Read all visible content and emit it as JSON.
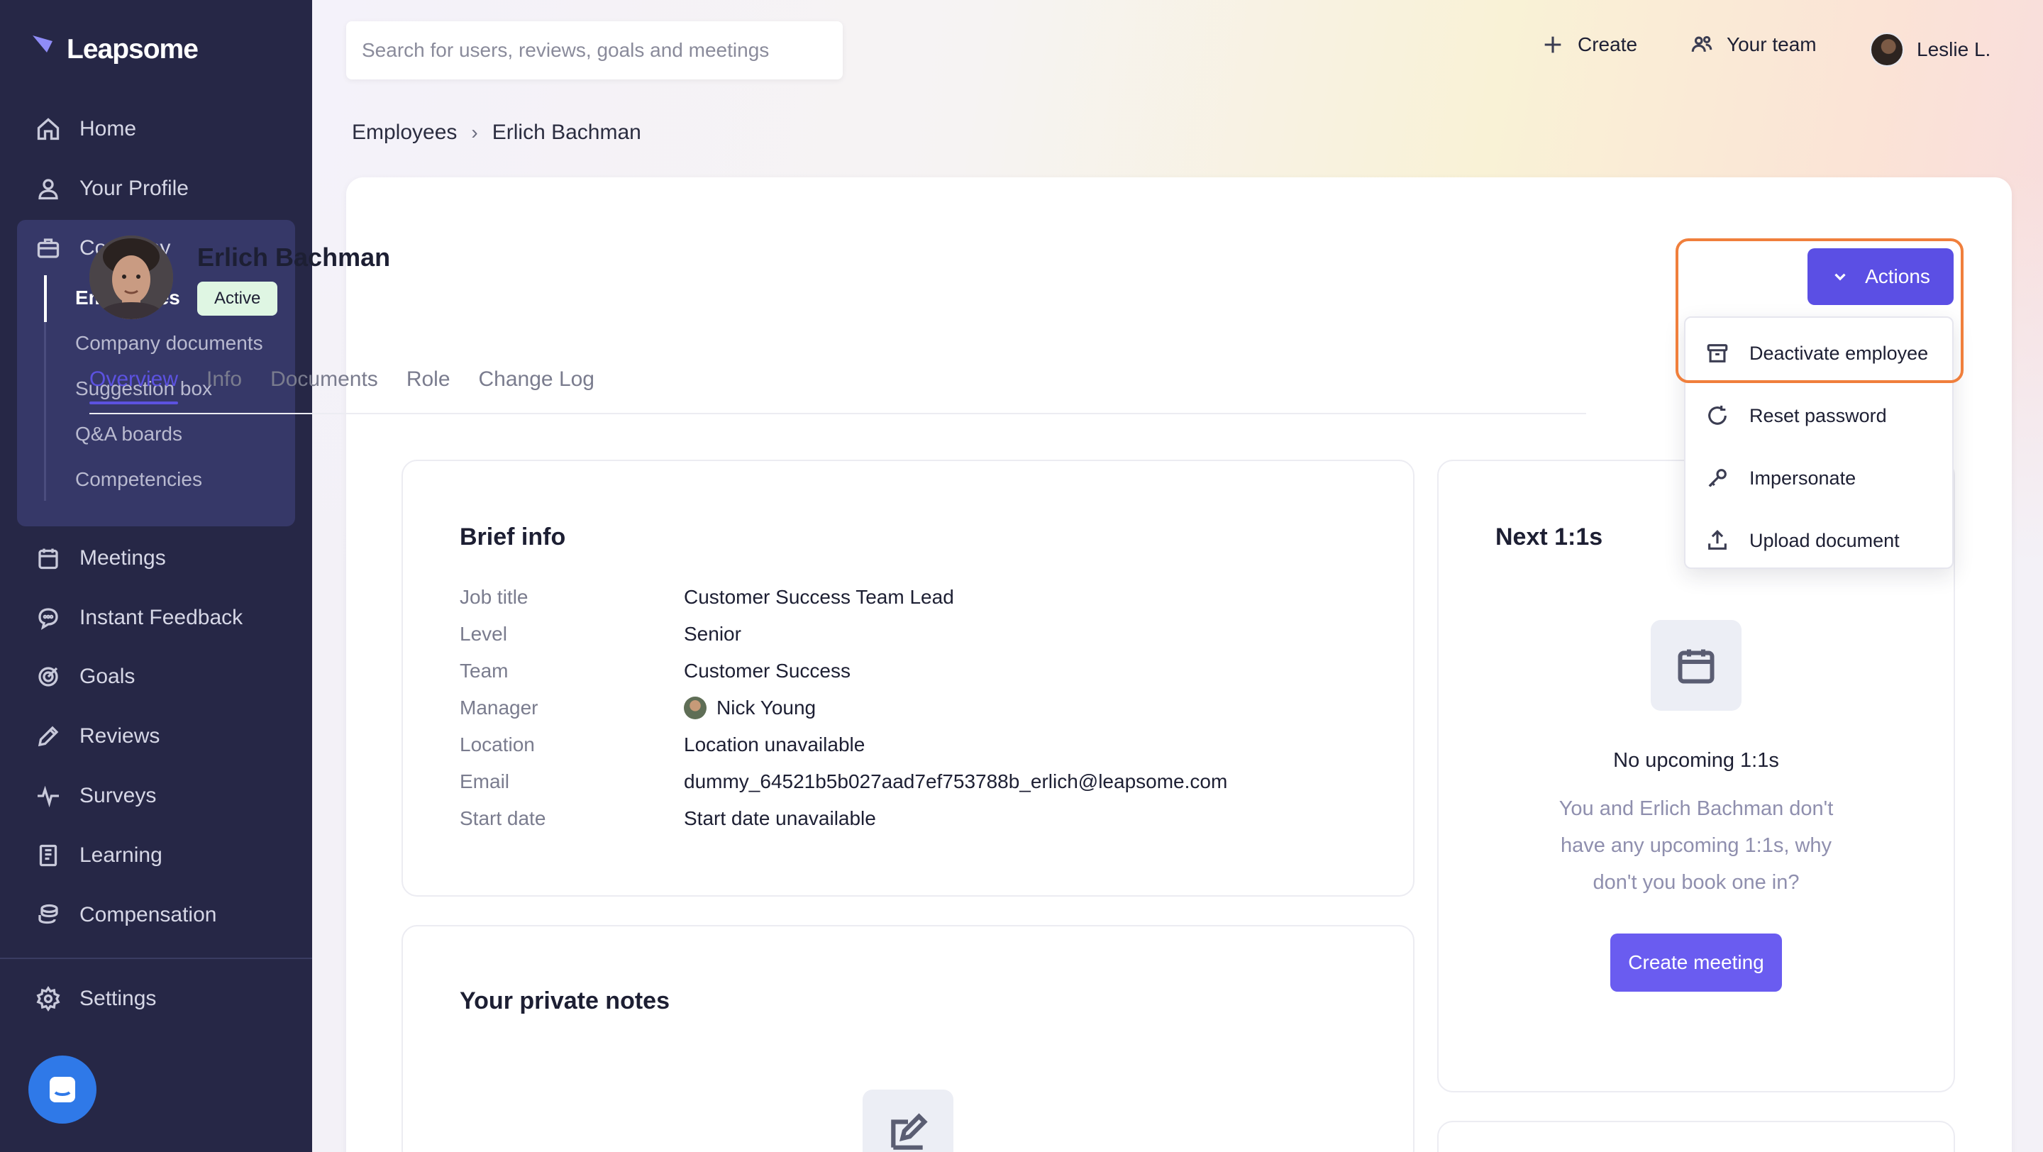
{
  "app": {
    "name": "Leapsome"
  },
  "sidebar": {
    "items": [
      {
        "label": "Home",
        "icon": "home-icon"
      },
      {
        "label": "Your Profile",
        "icon": "user-icon"
      },
      {
        "label": "Company",
        "icon": "briefcase-icon"
      },
      {
        "label": "Meetings",
        "icon": "calendar-icon"
      },
      {
        "label": "Instant Feedback",
        "icon": "chat-bubble-icon"
      },
      {
        "label": "Goals",
        "icon": "target-icon"
      },
      {
        "label": "Reviews",
        "icon": "pencil-icon"
      },
      {
        "label": "Surveys",
        "icon": "pulse-icon"
      },
      {
        "label": "Learning",
        "icon": "book-icon"
      },
      {
        "label": "Compensation",
        "icon": "coins-icon"
      },
      {
        "label": "Settings",
        "icon": "gear-icon"
      }
    ],
    "company_sub": [
      {
        "label": "Employees",
        "active": true
      },
      {
        "label": "Company documents"
      },
      {
        "label": "Suggestion box"
      },
      {
        "label": "Q&A boards"
      },
      {
        "label": "Competencies"
      }
    ]
  },
  "header": {
    "search_placeholder": "Search for users, reviews, goals and meetings",
    "create_label": "Create",
    "team_label": "Your team",
    "user_label": "Leslie L."
  },
  "breadcrumb": {
    "parent": "Employees",
    "current": "Erlich Bachman"
  },
  "profile": {
    "name": "Erlich Bachman",
    "status": "Active"
  },
  "tabs": [
    "Overview",
    "Info",
    "Documents",
    "Role",
    "Change Log"
  ],
  "actions": {
    "button_label": "Actions",
    "menu": [
      {
        "label": "Deactivate employee",
        "icon": "archive-icon"
      },
      {
        "label": "Reset password",
        "icon": "refresh-icon"
      },
      {
        "label": "Impersonate",
        "icon": "key-icon"
      },
      {
        "label": "Upload document",
        "icon": "upload-icon"
      }
    ]
  },
  "brief_info": {
    "title": "Brief info",
    "rows": [
      {
        "label": "Job title",
        "value": "Customer Success Team Lead"
      },
      {
        "label": "Level",
        "value": "Senior"
      },
      {
        "label": "Team",
        "value": "Customer Success"
      },
      {
        "label": "Manager",
        "value": "Nick Young"
      },
      {
        "label": "Location",
        "value": "Location unavailable"
      },
      {
        "label": "Email",
        "value": "dummy_64521b5b027aad7ef753788b_erlich@leapsome.com"
      },
      {
        "label": "Start date",
        "value": "Start date unavailable"
      }
    ]
  },
  "next_one_on_ones": {
    "title": "Next 1:1s",
    "empty_title": "No upcoming 1:1s",
    "empty_line1": "You and Erlich Bachman don't",
    "empty_line2": "have any upcoming 1:1s, why",
    "empty_line3": "don't you book one in?",
    "button_label": "Create meeting"
  },
  "private_notes": {
    "title": "Your private notes"
  },
  "colors": {
    "accent": "#5b4fe4",
    "sidebar": "#262746",
    "highlight": "#f07f3c"
  }
}
